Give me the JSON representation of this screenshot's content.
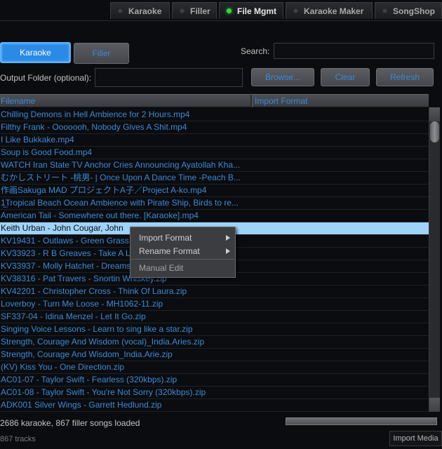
{
  "tabs": [
    {
      "label": "Karaoke",
      "active": false
    },
    {
      "label": "Filler",
      "active": false
    },
    {
      "label": "File Mgmt",
      "active": true
    },
    {
      "label": "Karaoke Maker",
      "active": false
    },
    {
      "label": "SongShop",
      "active": false
    }
  ],
  "mode_buttons": {
    "karaoke": "Karaoke",
    "filler": "Filler"
  },
  "search": {
    "label": "Search:",
    "value": ""
  },
  "output_folder": {
    "label": "Output Folder (optional):",
    "value": ""
  },
  "buttons": {
    "browse": "Browse...",
    "clear": "Clear",
    "refresh": "Refresh"
  },
  "table": {
    "columns": [
      "Filename",
      "Import Format"
    ],
    "rows": [
      "Chilling Demons in Hell Ambience for 2 Hours.mp4",
      "Filthy Frank - Ooooooh, Nobody Gives A Shit.mp4",
      "I Like Bukkake.mp4",
      "Soup is Good Food.mp4",
      "WATCH Iran State TV Anchor Cries Announcing Ayatollah Kha...",
      "むかしストリート -桃男- | Once Upon A Dance Time -Peach B...",
      "作画Sakuga MAD プロジェクトA子／Project A-ko.mp4",
      "1̲Tropical Beach Ocean Ambience with Pirate Ship, Birds to re...",
      "American Tail - Somewhere out there. [Karaoke].mp4",
      "Keith Urban - John Cougar, John",
      "KV19431 - Outlaws - Green Grass",
      "KV33923 - R B Greaves - Take A L",
      "KV33937 - Molly Hatchet - Dreams",
      "KV38316 - Pat Travers - Snortin Whiskey.zip",
      "KV42201 - Christopher Cross - Think Of Laura.zip",
      "Loverboy - Turn Me Loose - MH1062-11.zip",
      "SF337-04 - Idina Menzel - Let It Go.zip",
      "Singing Voice Lessons - Learn to sing like a star.zip",
      "Strength, Courage And Wisdom (vocal)_India.Aries.zip",
      "Strength, Courage And Wisdom_India.Arie.zip",
      "(KV) Kiss You - One Direction.zip",
      "AC01-07 - Taylor Swift - Fearless (320kbps).zip",
      "AC01-08 - Taylor Swift - You're Not Sorry (320kbps).zip",
      "ADK001 Silver Wings - Garrett Hedlund.zip"
    ],
    "selected_index": 9
  },
  "context_menu": {
    "import_format": "Import Format",
    "rename_format": "Rename Format",
    "manual_edit": "Manual Edit"
  },
  "status": "2686 karaoke, 867 filler songs loaded",
  "tracks": "867 tracks",
  "import_media": "Import Media",
  "colors": {
    "accent": "#3b8ad6",
    "selected_row": "#9ed4fa",
    "active_led": "#2fdc2f",
    "karaoke_button": "#2a8ae6"
  }
}
